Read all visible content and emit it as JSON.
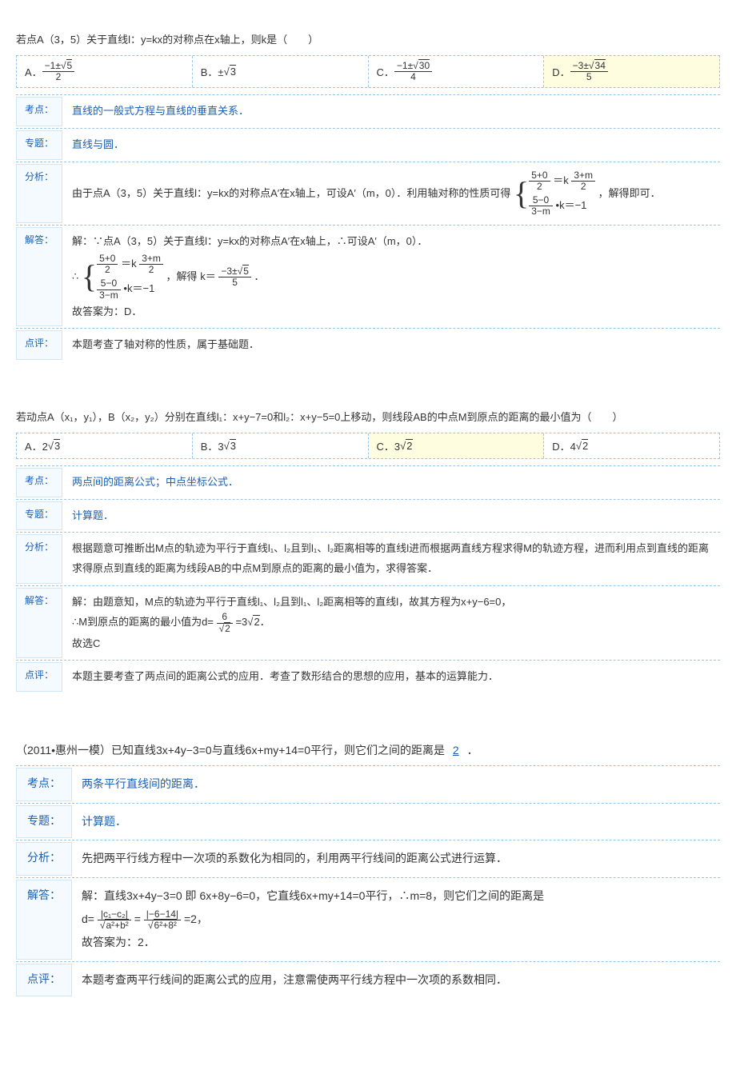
{
  "labels": {
    "kaodian": "考点：",
    "zhuanti": "专题：",
    "fenxi": "分析：",
    "jieda": "解答：",
    "dianping": "点评："
  },
  "p1": {
    "question": "若点A（3，5）关于直线l：y=kx的对称点在x轴上，则k是（　　）",
    "optA_pre": "A．",
    "optB_pre": "B．±",
    "optB_rad": "3",
    "optC_pre": "C．",
    "optD_pre": "D．",
    "fracA_num_a": "−1±",
    "fracA_num_r": "5",
    "fracA_den": "2",
    "fracC_num_a": "−1±",
    "fracC_num_r": "30",
    "fracC_den": "4",
    "fracD_num_a": "−3±",
    "fracD_num_r": "34",
    "fracD_den": "5",
    "kaodian": "直线的一般式方程与直线的垂直关系．",
    "zhuanti": "直线与圆．",
    "fenxi_a": "由于点A（3，5）关于直线l：y=kx的对称点A′在x轴上，可设A′（m，0）．利用轴对称的性质可得",
    "fenxi_b": "，解得即可．",
    "sys_eq1_l_num": "5+0",
    "sys_eq1_l_den": "2",
    "sys_eq1_mid": "＝k",
    "sys_eq1_r_num": "3+m",
    "sys_eq1_r_den": "2",
    "sys_eq2_num": "5−0",
    "sys_eq2_den": "3−m",
    "sys_eq2_tail": "•k＝−1",
    "jieda_l1": "解：∵点A（3，5）关于直线l：y=kx的对称点A′在x轴上，∴可设A′（m，0）．",
    "jieda_l2_pre": "∴",
    "jieda_l2_mid": "，解得",
    "jieda_k_eq": "k＝",
    "jieda_k_num_a": "−3±",
    "jieda_k_num_r": "5",
    "jieda_k_den": "5",
    "jieda_l2_end": "．",
    "jieda_l3": "故答案为：D．",
    "dianping": "本题考查了轴对称的性质，属于基础题．"
  },
  "p2": {
    "question": "若动点A（x₁，y₁），B（x₂，y₂）分别在直线l₁：x+y−7=0和l₂：x+y−5=0上移动，则线段AB的中点M到原点的距离的最小值为（　　）",
    "optA_pre": "A．2",
    "optA_rad": "3",
    "optB_pre": "B．3",
    "optB_rad": "3",
    "optC_pre": "C．3",
    "optC_rad": "2",
    "optD_pre": "D．4",
    "optD_rad": "2",
    "kaodian": "两点间的距离公式；中点坐标公式．",
    "zhuanti": "计算题．",
    "fenxi": "根据题意可推断出M点的轨迹为平行于直线l₁、l₂且到l₁、l₂距离相等的直线l进而根据两直线方程求得M的轨迹方程，进而利用点到直线的距离求得原点到直线的距离为线段AB的中点M到原点的距离的最小值为，求得答案．",
    "jieda_l1": "解：由题意知，M点的轨迹为平行于直线l₁、l₂且到l₁、l₂距离相等的直线l，故其方程为x+y−6=0，",
    "jieda_l2_pre": "∴M到原点的距离的最小值为d=",
    "jieda_frac_num": "6",
    "jieda_frac_den_r": "2",
    "jieda_l2_mid": "=3",
    "jieda_l2_rad": "2",
    "jieda_l2_end": "．",
    "jieda_l3": "故选C",
    "dianping": "本题主要考查了两点间的距离公式的应用．考查了数形结合的思想的应用，基本的运算能力．"
  },
  "p3": {
    "question_pre": "（2011•惠州一模）已知直线3x+4y−3=0与直线6x+my+14=0平行，则它们之间的距离是",
    "question_ans": "2",
    "question_end": "．",
    "kaodian": "两条平行直线间的距离．",
    "zhuanti": "计算题．",
    "fenxi": "先把两平行线方程中一次项的系数化为相同的，利用两平行线间的距离公式进行运算．",
    "jieda_l1": "解：直线3x+4y−3=0 即 6x+8y−6=0，它直线6x+my+14=0平行，∴m=8，则它们之间的距离是",
    "jieda_l2_pre": "d=",
    "jieda_f1_num": "|c₁−c₂|",
    "jieda_f1_den_pre": "a²+b²",
    "jieda_eq": "=",
    "jieda_f2_num": "|−6−14|",
    "jieda_f2_den_pre": "6²+8²",
    "jieda_l2_end": "=2，",
    "jieda_l3": "故答案为：2．",
    "dianping": "本题考查两平行线间的距离公式的应用，注意需使两平行线方程中一次项的系数相同．"
  }
}
